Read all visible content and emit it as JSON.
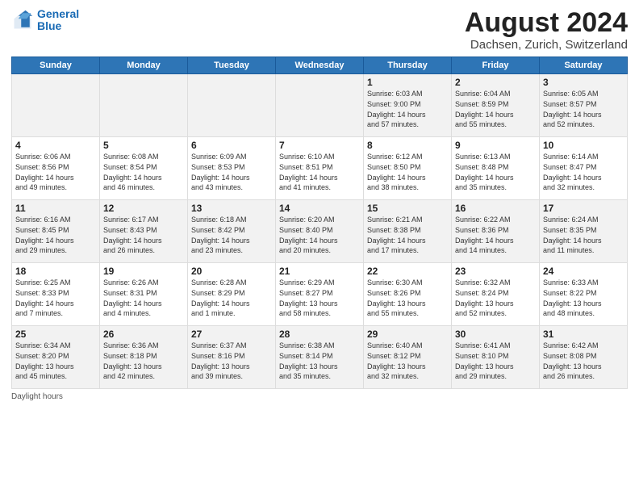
{
  "logo": {
    "line1": "General",
    "line2": "Blue"
  },
  "title": "August 2024",
  "subtitle": "Dachsen, Zurich, Switzerland",
  "days_of_week": [
    "Sunday",
    "Monday",
    "Tuesday",
    "Wednesday",
    "Thursday",
    "Friday",
    "Saturday"
  ],
  "footer": "Daylight hours",
  "weeks": [
    [
      {
        "day": "",
        "info": ""
      },
      {
        "day": "",
        "info": ""
      },
      {
        "day": "",
        "info": ""
      },
      {
        "day": "",
        "info": ""
      },
      {
        "day": "1",
        "info": "Sunrise: 6:03 AM\nSunset: 9:00 PM\nDaylight: 14 hours\nand 57 minutes."
      },
      {
        "day": "2",
        "info": "Sunrise: 6:04 AM\nSunset: 8:59 PM\nDaylight: 14 hours\nand 55 minutes."
      },
      {
        "day": "3",
        "info": "Sunrise: 6:05 AM\nSunset: 8:57 PM\nDaylight: 14 hours\nand 52 minutes."
      }
    ],
    [
      {
        "day": "4",
        "info": "Sunrise: 6:06 AM\nSunset: 8:56 PM\nDaylight: 14 hours\nand 49 minutes."
      },
      {
        "day": "5",
        "info": "Sunrise: 6:08 AM\nSunset: 8:54 PM\nDaylight: 14 hours\nand 46 minutes."
      },
      {
        "day": "6",
        "info": "Sunrise: 6:09 AM\nSunset: 8:53 PM\nDaylight: 14 hours\nand 43 minutes."
      },
      {
        "day": "7",
        "info": "Sunrise: 6:10 AM\nSunset: 8:51 PM\nDaylight: 14 hours\nand 41 minutes."
      },
      {
        "day": "8",
        "info": "Sunrise: 6:12 AM\nSunset: 8:50 PM\nDaylight: 14 hours\nand 38 minutes."
      },
      {
        "day": "9",
        "info": "Sunrise: 6:13 AM\nSunset: 8:48 PM\nDaylight: 14 hours\nand 35 minutes."
      },
      {
        "day": "10",
        "info": "Sunrise: 6:14 AM\nSunset: 8:47 PM\nDaylight: 14 hours\nand 32 minutes."
      }
    ],
    [
      {
        "day": "11",
        "info": "Sunrise: 6:16 AM\nSunset: 8:45 PM\nDaylight: 14 hours\nand 29 minutes."
      },
      {
        "day": "12",
        "info": "Sunrise: 6:17 AM\nSunset: 8:43 PM\nDaylight: 14 hours\nand 26 minutes."
      },
      {
        "day": "13",
        "info": "Sunrise: 6:18 AM\nSunset: 8:42 PM\nDaylight: 14 hours\nand 23 minutes."
      },
      {
        "day": "14",
        "info": "Sunrise: 6:20 AM\nSunset: 8:40 PM\nDaylight: 14 hours\nand 20 minutes."
      },
      {
        "day": "15",
        "info": "Sunrise: 6:21 AM\nSunset: 8:38 PM\nDaylight: 14 hours\nand 17 minutes."
      },
      {
        "day": "16",
        "info": "Sunrise: 6:22 AM\nSunset: 8:36 PM\nDaylight: 14 hours\nand 14 minutes."
      },
      {
        "day": "17",
        "info": "Sunrise: 6:24 AM\nSunset: 8:35 PM\nDaylight: 14 hours\nand 11 minutes."
      }
    ],
    [
      {
        "day": "18",
        "info": "Sunrise: 6:25 AM\nSunset: 8:33 PM\nDaylight: 14 hours\nand 7 minutes."
      },
      {
        "day": "19",
        "info": "Sunrise: 6:26 AM\nSunset: 8:31 PM\nDaylight: 14 hours\nand 4 minutes."
      },
      {
        "day": "20",
        "info": "Sunrise: 6:28 AM\nSunset: 8:29 PM\nDaylight: 14 hours\nand 1 minute."
      },
      {
        "day": "21",
        "info": "Sunrise: 6:29 AM\nSunset: 8:27 PM\nDaylight: 13 hours\nand 58 minutes."
      },
      {
        "day": "22",
        "info": "Sunrise: 6:30 AM\nSunset: 8:26 PM\nDaylight: 13 hours\nand 55 minutes."
      },
      {
        "day": "23",
        "info": "Sunrise: 6:32 AM\nSunset: 8:24 PM\nDaylight: 13 hours\nand 52 minutes."
      },
      {
        "day": "24",
        "info": "Sunrise: 6:33 AM\nSunset: 8:22 PM\nDaylight: 13 hours\nand 48 minutes."
      }
    ],
    [
      {
        "day": "25",
        "info": "Sunrise: 6:34 AM\nSunset: 8:20 PM\nDaylight: 13 hours\nand 45 minutes."
      },
      {
        "day": "26",
        "info": "Sunrise: 6:36 AM\nSunset: 8:18 PM\nDaylight: 13 hours\nand 42 minutes."
      },
      {
        "day": "27",
        "info": "Sunrise: 6:37 AM\nSunset: 8:16 PM\nDaylight: 13 hours\nand 39 minutes."
      },
      {
        "day": "28",
        "info": "Sunrise: 6:38 AM\nSunset: 8:14 PM\nDaylight: 13 hours\nand 35 minutes."
      },
      {
        "day": "29",
        "info": "Sunrise: 6:40 AM\nSunset: 8:12 PM\nDaylight: 13 hours\nand 32 minutes."
      },
      {
        "day": "30",
        "info": "Sunrise: 6:41 AM\nSunset: 8:10 PM\nDaylight: 13 hours\nand 29 minutes."
      },
      {
        "day": "31",
        "info": "Sunrise: 6:42 AM\nSunset: 8:08 PM\nDaylight: 13 hours\nand 26 minutes."
      }
    ]
  ]
}
